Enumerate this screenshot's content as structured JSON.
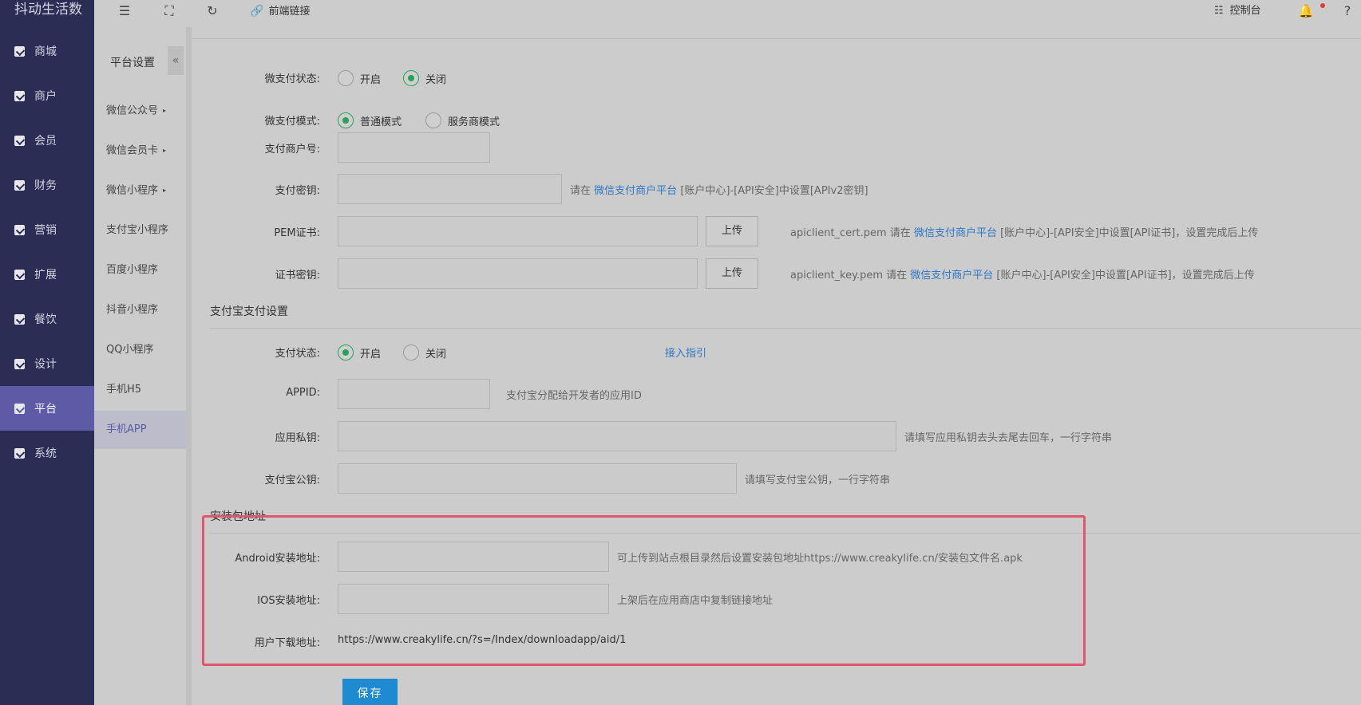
{
  "app": {
    "logo": "抖动生活数"
  },
  "leftnav": {
    "items": [
      {
        "label": "商城",
        "icon": "shop-icon"
      },
      {
        "label": "商户",
        "icon": "merchant-icon"
      },
      {
        "label": "会员",
        "icon": "member-icon"
      },
      {
        "label": "财务",
        "icon": "finance-icon"
      },
      {
        "label": "营销",
        "icon": "megaphone-icon"
      },
      {
        "label": "扩展",
        "icon": "cube-icon"
      },
      {
        "label": "餐饮",
        "icon": "dish-icon"
      },
      {
        "label": "设计",
        "icon": "puzzle-icon"
      },
      {
        "label": "平台",
        "icon": "grid-icon"
      },
      {
        "label": "系统",
        "icon": "system-icon"
      }
    ],
    "active_index": 8
  },
  "topbar": {
    "frontend_link_label": "前端链接",
    "console_label": "控制台"
  },
  "subnav": {
    "title": "平台设置",
    "collapse_glyph": "«",
    "items": [
      {
        "label": "微信公众号",
        "has_arrow": true
      },
      {
        "label": "微信会员卡",
        "has_arrow": true
      },
      {
        "label": "微信小程序",
        "has_arrow": true
      },
      {
        "label": "支付宝小程序",
        "has_arrow": false
      },
      {
        "label": "百度小程序",
        "has_arrow": false
      },
      {
        "label": "抖音小程序",
        "has_arrow": false
      },
      {
        "label": "QQ小程序",
        "has_arrow": false
      },
      {
        "label": "手机H5",
        "has_arrow": false
      },
      {
        "label": "手机APP",
        "has_arrow": false
      }
    ],
    "active_label": "手机APP"
  },
  "wxpay": {
    "status_label": "微支付状态:",
    "status_options": [
      "开启",
      "关闭"
    ],
    "status_selected": "关闭",
    "mode_label": "微支付模式:",
    "mode_options": [
      "普通模式",
      "服务商模式"
    ],
    "mode_selected": "普通模式",
    "merchant_no_label": "支付商户号:",
    "merchant_no_value": "",
    "secret_label": "支付密钥:",
    "secret_value": "",
    "secret_hint_prefix": "请在",
    "secret_hint_link": "微信支付商户平台",
    "secret_hint_suffix": "[账户中心]-[API安全]中设置[APIv2密钥]",
    "pem_label": "PEM证书:",
    "pem_upload": "上传",
    "pem_hint_prefix": "apiclient_cert.pem 请在",
    "pem_hint_link": "微信支付商户平台",
    "pem_hint_suffix": "[账户中心]-[API安全]中设置[API证书]，设置完成后上传",
    "key_label": "证书密钥:",
    "key_upload": "上传",
    "key_hint_prefix": "apiclient_key.pem 请在",
    "key_hint_link": "微信支付商户平台",
    "key_hint_suffix": "[账户中心]-[API安全]中设置[API证书]，设置完成后上传"
  },
  "alipay": {
    "section_title": "支付宝支付设置",
    "status_label": "支付状态:",
    "status_options": [
      "开启",
      "关闭"
    ],
    "status_selected": "开启",
    "guide_link": "接入指引",
    "appid_label": "APPID:",
    "appid_value": "",
    "appid_hint": "支付宝分配给开发者的应用ID",
    "private_key_label": "应用私钥:",
    "private_key_value": "",
    "private_key_hint": "请填写应用私钥去头去尾去回车，一行字符串",
    "public_key_label": "支付宝公钥:",
    "public_key_value": "",
    "public_key_hint": "请填写支付宝公钥，一行字符串"
  },
  "install": {
    "section_title": "安装包地址",
    "android_label": "Android安装地址:",
    "android_value": "",
    "android_hint": "可上传到站点根目录然后设置安装包地址https://www.creakylife.cn/安装包文件名.apk",
    "ios_label": "IOS安装地址:",
    "ios_value": "",
    "ios_hint": "上架后在应用商店中复制链接地址",
    "download_label": "用户下载地址:",
    "download_value": "https://www.creakylife.cn/?s=/Index/downloadapp/aid/1"
  },
  "actions": {
    "save_label": "保存"
  },
  "colors": {
    "nav_bg": "#2b2d54",
    "nav_active": "#5d5ba6",
    "radio_on": "#2aa05b",
    "link": "#2e77c4",
    "save_btn": "#1e8ad2",
    "highlight_border": "#e0566a"
  }
}
